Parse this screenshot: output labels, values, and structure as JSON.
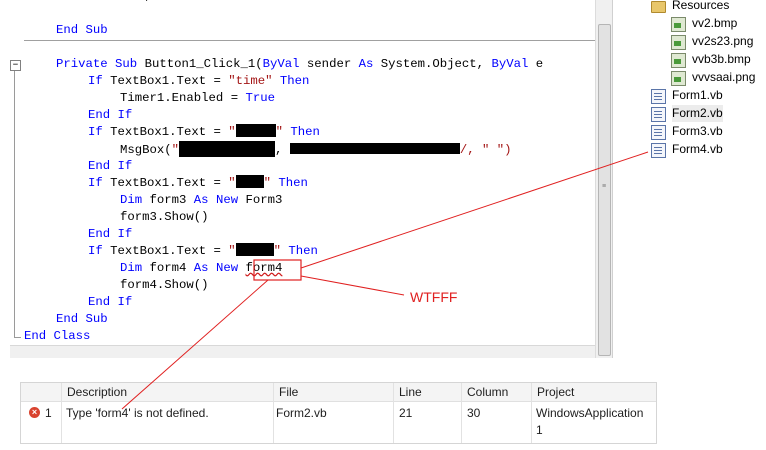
{
  "code": {
    "top_partial": "            ,            ",
    "line_end_sub": "End Sub",
    "sub_private": "Private",
    "sub_kw": "Sub",
    "sub_name": " Button1_Click_1(",
    "sub_byval1": "ByVal",
    "sub_sender": " sender ",
    "sub_as": "As",
    "sub_type": " System.Object, ",
    "sub_byval2": "ByVal",
    "sub_e": " e ",
    "if1_cond": " TextBox1.Text = ",
    "if1_str": "\"time\"",
    "then": "Then",
    "if_kw": "If",
    "end_kw": "End",
    "timer_line": "Timer1.Enabled = ",
    "true_kw": "True",
    "msgbox": "MsgBox(",
    "msgbox_q": "\"",
    "msgbox_mid": ", ",
    "msgbox_end": "/, \" \")",
    "dim_kw": "Dim",
    "as_kw": "As",
    "new_kw": "New",
    "form3_var": " form3 ",
    "form3_type": " Form3",
    "form3_show": "form3.Show()",
    "form4_var": " form4 ",
    "form4_type": "form4",
    "form4_show": "form4.Show()",
    "end_sub_text": "End Sub",
    "end_class_text": "End Class",
    "str_q": "\"",
    "str_q_end": "\""
  },
  "solution": {
    "folder": "Resources",
    "files": [
      "vv2.bmp",
      "vv2s23.png",
      "vvb3b.bmp",
      "vvvsaai.png"
    ],
    "forms": [
      "Form1.vb",
      "Form2.vb",
      "Form3.vb",
      "Form4.vb"
    ]
  },
  "error_list": {
    "headers": {
      "description": "Description",
      "file": "File",
      "line": "Line",
      "column": "Column",
      "project": "Project"
    },
    "row": {
      "index": "1",
      "description": "Type 'form4' is not defined.",
      "file": "Form2.vb",
      "line": "21",
      "column": "30",
      "project_line1": "WindowsApplication",
      "project_line2": "1"
    }
  },
  "annotation": "WTFFF",
  "colors": {
    "keyword": "#0000ff",
    "string": "#a31515",
    "annotation": "#e02020"
  },
  "icons": [
    "folder-icon",
    "image-file-icon",
    "vb-form-icon",
    "error-icon",
    "collapse-icon"
  ]
}
